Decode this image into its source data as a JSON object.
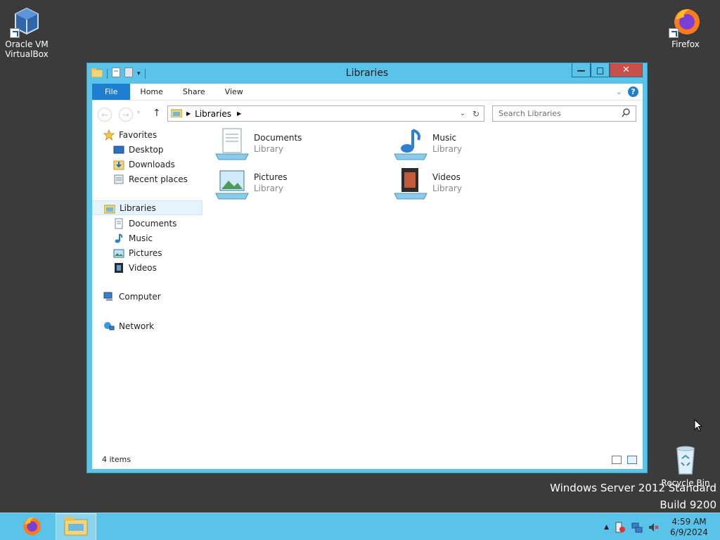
{
  "desktop": {
    "icons": [
      {
        "name": "virtualbox",
        "label_line1": "Oracle VM",
        "label_line2": "VirtualBox"
      },
      {
        "name": "firefox",
        "label": "Firefox"
      },
      {
        "name": "recycle-bin",
        "label": "Recycle Bin"
      }
    ],
    "watermark": {
      "line1": "Windows Server 2012 Standard",
      "line2": "Build 9200"
    }
  },
  "window": {
    "title": "Libraries",
    "controls": {
      "minimize": "—",
      "maximize": "□",
      "close": "✕"
    },
    "ribbon": {
      "tabs": [
        "File",
        "Home",
        "Share",
        "View"
      ],
      "help_label": "?"
    },
    "address": {
      "breadcrumb": [
        "Libraries"
      ],
      "search_placeholder": "Search Libraries"
    },
    "nav_pane": {
      "favorites": {
        "label": "Favorites",
        "items": [
          "Desktop",
          "Downloads",
          "Recent places"
        ]
      },
      "libraries": {
        "label": "Libraries",
        "items": [
          "Documents",
          "Music",
          "Pictures",
          "Videos"
        ]
      },
      "computer": "Computer",
      "network": "Network"
    },
    "libraries": [
      {
        "name": "Documents",
        "type": "Library"
      },
      {
        "name": "Music",
        "type": "Library"
      },
      {
        "name": "Pictures",
        "type": "Library"
      },
      {
        "name": "Videos",
        "type": "Library"
      }
    ],
    "status": {
      "item_count": "4 items"
    }
  },
  "taskbar": {
    "clock": {
      "time": "4:59 AM",
      "date": "6/9/2024"
    }
  },
  "colors": {
    "window_frame": "#5ac3e9",
    "file_tab": "#1e7fd0",
    "close_button": "#c7504a",
    "desktop": "#3b3b3b"
  }
}
